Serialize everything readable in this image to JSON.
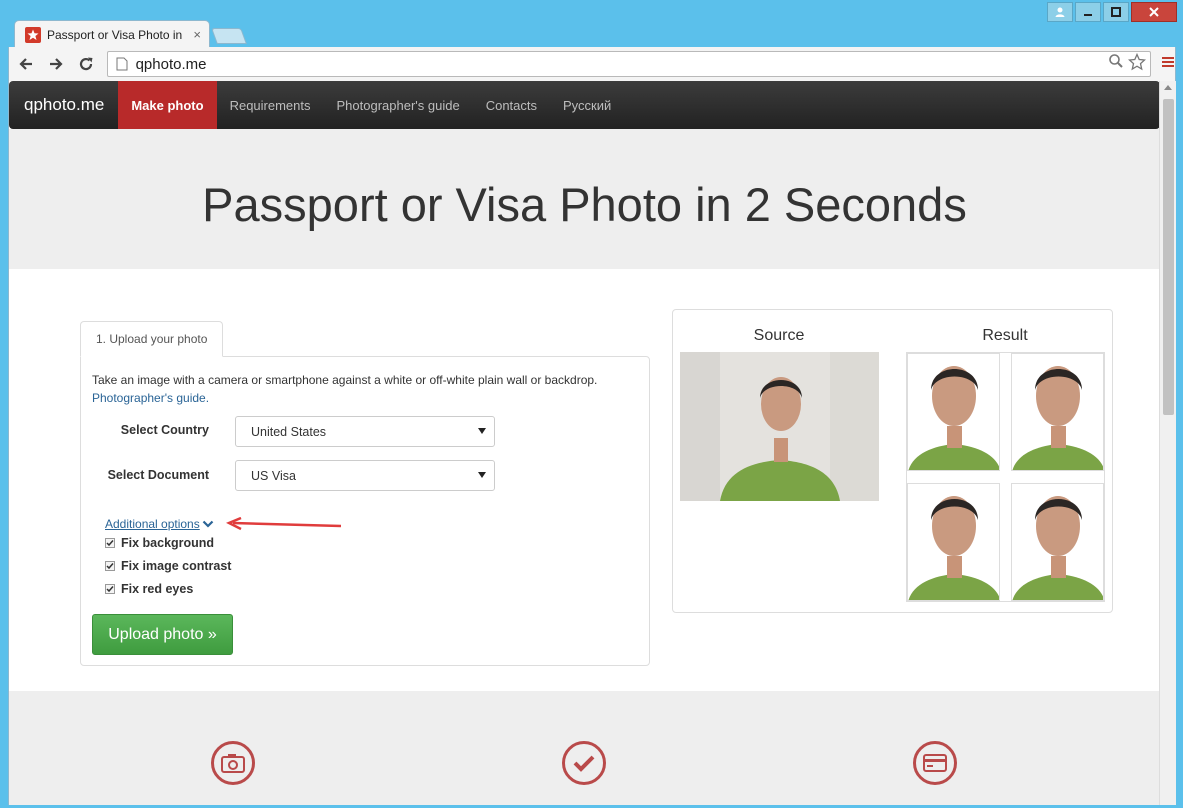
{
  "browser": {
    "tab_title": "Passport or Visa Photo in",
    "url": "qphoto.me"
  },
  "navbar": {
    "brand": "qphoto.me",
    "items": [
      {
        "label": "Make photo",
        "active": true
      },
      {
        "label": "Requirements",
        "active": false
      },
      {
        "label": "Photographer's guide",
        "active": false
      },
      {
        "label": "Contacts",
        "active": false
      },
      {
        "label": "Русский",
        "active": false
      }
    ]
  },
  "hero": {
    "title": "Passport or Visa Photo in 2 Seconds"
  },
  "upload": {
    "tab_label": "1. Upload your photo",
    "intro": "Take an image with a camera or smartphone against a white or off-white plain wall or backdrop.",
    "guide_link": "Photographer's guide.",
    "country_label": "Select Country",
    "country_value": "United States",
    "document_label": "Select Document",
    "document_value": "US Visa",
    "additional_options": "Additional options",
    "options": [
      {
        "label": "Fix background",
        "checked": true
      },
      {
        "label": "Fix image contrast",
        "checked": true
      },
      {
        "label": "Fix red eyes",
        "checked": true
      }
    ],
    "button_label": "Upload photo »"
  },
  "examples": {
    "source_label": "Source",
    "result_label": "Result"
  },
  "colors": {
    "accent": "#b82a2a",
    "button_green": "#4cae4c",
    "link": "#2a6496"
  }
}
